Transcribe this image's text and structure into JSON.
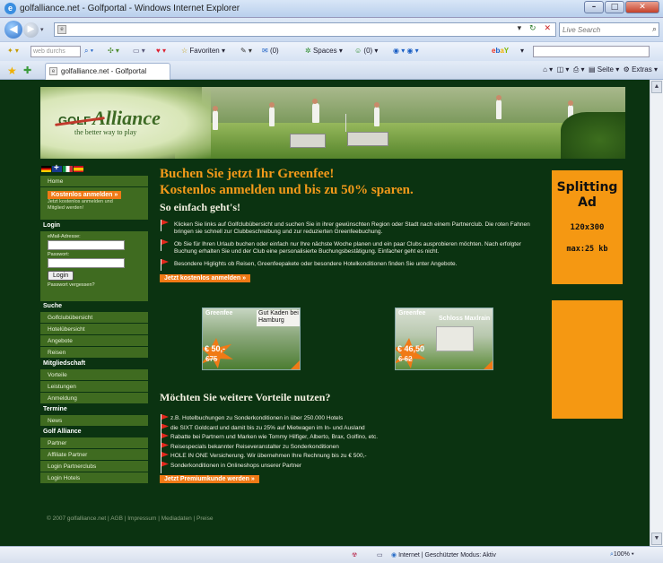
{
  "window": {
    "title": "golfalliance.net - Golfportal - Windows Internet Explorer"
  },
  "address_bar": {
    "url": "",
    "search_placeholder": "Live Search"
  },
  "toolbar": {
    "search_placeholder": "web durchs",
    "favorites": "Favoriten",
    "mail_count": "(0)",
    "spaces": "Spaces",
    "contacts_count": "(0)"
  },
  "tab": {
    "label": "golfalliance.net - Golfportal"
  },
  "command_bar": {
    "page": "Seite",
    "extras": "Extras"
  },
  "logo": {
    "golf": "GOLF",
    "alliance": "Alliance",
    "tagline": "the better way to play"
  },
  "sidebar": {
    "home": "Home",
    "register_button": "Kostenlos anmelden »",
    "register_note": [
      "Jetzt kostenlos anmelden und",
      "Mitglied werden!"
    ],
    "login_heading": "Login",
    "email_label": "eMail-Adresse:",
    "password_label": "Passwort:",
    "login_button": "Login",
    "forgot": "Passwort vergessen?",
    "search_heading": "Suche",
    "search_items": [
      "Golfclubübersicht",
      "Hotelübersicht",
      "Angebote",
      "Reisen"
    ],
    "members_heading": "Mitgliedschaft",
    "members_items": [
      "Vorteile",
      "Leistungen",
      "Anmeldung"
    ],
    "dates_heading": "Termine",
    "dates_items": [
      "News"
    ],
    "alliance_heading": "Golf Alliance",
    "alliance_items": [
      "Partner",
      "Affiliate Partner",
      "Login Partnerclubs",
      "Login Hotels"
    ]
  },
  "main": {
    "headline1": "Buchen Sie jetzt Ihr Greenfee!",
    "headline2": "Kostenlos anmelden und bis zu 50% sparen.",
    "subheading": "So einfach geht's!",
    "bullets": [
      "Klicken Sie links auf Golfclubübersicht und suchen Sie in ihrer gewünschten Region oder Stadt nach einem Partnerclub. Die roten Fahnen bringen sie schnell zur Clubbeschreibung und zur reduzierten Greenfeebuchung.",
      "Ob Sie für Ihren Urlaub buchen oder einfach nur Ihre nächste Woche planen und ein paar Clubs ausprobieren möchten. Nach erfolgter Buchung erhalten Sie und der Club eine personalisierte Buchungsbestätigung. Einfacher geht es nicht.",
      "Besondere Higlights ob Reisen, Greenfeepakete oder besondere Hotelkonditionen finden Sie unter Angebote."
    ],
    "register_button": "Jetzt kostenlos anmelden »",
    "offers": [
      {
        "label": "Greenfee",
        "place": "Gut Kaden bei Hamburg",
        "price": "€ 50,-",
        "old_price": "€75"
      },
      {
        "label": "Greenfee",
        "place": "Schloss Maxlrain",
        "price": "€ 46,50",
        "old_price": "€ 62"
      }
    ],
    "section2_heading": "Möchten Sie weitere Vorteile nutzen?",
    "advantages": [
      "z.B. Hotelbuchungen zu Sonderkonditionen in über 250.000 Hotels",
      "die SIXT Goldcard und damit bis zu 25% auf Mietwagen im In- und Ausland",
      "Rabatte bei Partnern und Marken wie Tommy Hilfiger, Alberto, Brax, Golfino, etc.",
      "Reisespecials bekannter Reiseveranstalter zu Sonderkonditionen",
      "HOLE IN ONE Versicherung. Wir übernehmen Ihre Rechnung bis zu € 500,-",
      "Sonderkonditionen in Onlineshops unserer Partner"
    ],
    "premium_button": "Jetzt Premiumkunde werden »"
  },
  "ad": {
    "line1": "Splitting",
    "line2": "Ad",
    "size": "120x300",
    "max": "max:25 kb"
  },
  "footer": {
    "copyright": "© 2007",
    "links": [
      "golfalliance.net",
      "AGB",
      "Impressum",
      "Mediadaten",
      "Preise"
    ]
  },
  "status": {
    "zone": "Internet | Geschützter Modus: Aktiv",
    "zoom": "100%"
  },
  "colors": {
    "page_bg": "#0b3311",
    "nav_green": "#3f6b20",
    "accent_orange": "#f07a16",
    "ad_orange": "#f59812"
  }
}
